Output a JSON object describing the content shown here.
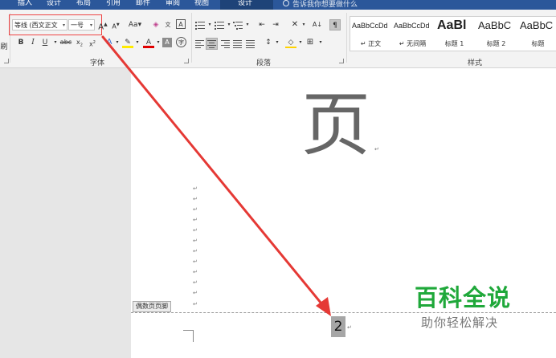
{
  "tabs": {
    "insert": "插入",
    "design": "设计",
    "layout": "布局",
    "references": "引用",
    "mailings": "邮件",
    "review": "审阅",
    "view": "视图",
    "header_footer_design": "设计"
  },
  "tell_me": "告诉我你想要做什么",
  "left_stub": "刷",
  "font": {
    "name": "等线 (西文正文",
    "size": "一号",
    "group_label": "字体"
  },
  "paragraph": {
    "group_label": "段落"
  },
  "styles": {
    "group_label": "样式",
    "items": [
      {
        "sample": "AaBbCcDd",
        "name": "↵ 正文"
      },
      {
        "sample": "AaBbCcDd",
        "name": "↵ 无间隔"
      },
      {
        "sample": "AaBl",
        "name": "标题 1"
      },
      {
        "sample": "AaBbC",
        "name": "标题 2"
      },
      {
        "sample": "AaBbC",
        "name": "标题"
      }
    ]
  },
  "document": {
    "big_char": "页",
    "paragraph_mark": "↵",
    "footer_tag": "偶数页页脚",
    "page_number": "2"
  },
  "watermark": {
    "main": "百科全说",
    "sub": "助你轻松解决"
  },
  "colors": {
    "tab_bar": "#2b579a",
    "annotation_red": "#e53935",
    "watermark_green": "#1fa83a"
  }
}
